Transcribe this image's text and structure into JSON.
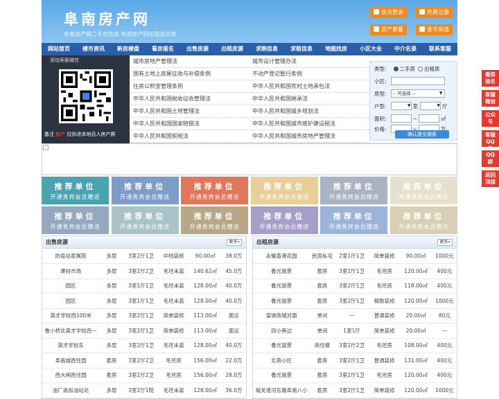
{
  "header": {
    "logo": "阜南房产网",
    "subtitle": "阜南房产网二手房信息    阜南房产网出租房信息",
    "buttons": [
      "会员登录",
      "免费注册",
      "房产套餐",
      "金币充值"
    ]
  },
  "nav": [
    "网站首页",
    "楼市资讯",
    "新房楼盘",
    "看房报名",
    "出售房源",
    "出租房源",
    "求购信息",
    "求租信息",
    "地图找房",
    "小区大全",
    "中介名录",
    "联系客服"
  ],
  "qr": {
    "caption": "添加客服微信",
    "note_prefix": "备注",
    "note_highlight": "房产",
    "note_suffix": "拉你进本地百人房产群"
  },
  "laws_left": [
    "城市房地产管理法",
    "国有土地上房屋征收与补偿条例",
    "住房公积金管理条例",
    "中华人民共和国税收征收管理法",
    "中华人民共和国土地管理法",
    "中华人民共和国国家赔偿法",
    "中华人民共和国契税法"
  ],
  "laws_right": [
    "城市设计管理办法",
    "不动产登记暂行条例",
    "中华人民共和国农村土地承包法",
    "中华人民共和国继承法",
    "中华人民共和国城乡规划法",
    "中华人民共和国城市维护建设税法",
    "中华人民共和国城市房地产管理法"
  ],
  "search": {
    "type_label": "类型:",
    "opt1": "二手房",
    "opt2": "出租房",
    "community_label": "小区:",
    "housetype_label": "房型:",
    "housetype_value": "-- 可选择 --",
    "layout_label": "户型:",
    "room_unit": "室",
    "hall_unit": "厅",
    "area_label": "面积:",
    "area_unit": "㎡",
    "price_label": "价格:",
    "price_unit": "万",
    "range_sep": "~",
    "submit": "确认提交搜索"
  },
  "tiles": {
    "title": "推荐单位",
    "subtitle": "开通贵宾会员赠送"
  },
  "sale": {
    "title": "出售房源",
    "more": "更多»",
    "rows": [
      [
        "防疫站家属院",
        "多层",
        "3室2厅1卫",
        "中档装修",
        "90.00㎡",
        "38.0万"
      ],
      [
        "建材市场",
        "多层",
        "3室2厅2卫",
        "毛坯未装",
        "140.62㎡",
        "45.0万"
      ],
      [
        "园区",
        "多层",
        "3室1厅1卫",
        "毛坯未装",
        "128.00㎡",
        "40.0万"
      ],
      [
        "园区",
        "多层",
        "3室1厅1卫",
        "毛坯未装",
        "128.00㎡",
        "40.0万"
      ],
      [
        "英才学校西100米",
        "多层",
        "3室2厅1卫",
        "简单装修",
        "113.00㎡",
        "面议"
      ],
      [
        "鲁小桥北英才学校西一",
        "多层",
        "3室2厅1卫",
        "简单装修",
        "113.00㎡",
        "面议"
      ],
      [
        "英才学校东",
        "多层",
        "3室2厅1卫",
        "毛坯未装",
        "128.00㎡",
        "40.0万"
      ],
      [
        "阜南城西住园",
        "套房",
        "3室2厅2卫",
        "毛坯房",
        "156.00㎡",
        "22.0万"
      ],
      [
        "西大闸西住园",
        "套房",
        "3室2厅2卫",
        "毛坯房",
        "156.00㎡",
        "28.0万"
      ],
      [
        "油厂南加油站北",
        "多层",
        "3室2厅1院",
        "毛坯未装",
        "128.00㎡",
        "36.0万"
      ]
    ]
  },
  "rent": {
    "title": "出租房源",
    "more": "更多»",
    "rows": [
      [
        "永耀香港花园",
        "民房私宅",
        "2室1厅1卫",
        "简单装修",
        "90.00㎡",
        "1000元"
      ],
      [
        "春光丽景",
        "套房",
        "3室2厅1卫",
        "毛坯房",
        "120.00㎡",
        "400元"
      ],
      [
        "春光丽景",
        "套房",
        "3室2厅1卫",
        "毛坯房",
        "118.00㎡",
        "400元"
      ],
      [
        "春光丽景",
        "套房",
        "3室2厅1卫",
        "精致装修",
        "120.00㎡",
        "1000元"
      ],
      [
        "富坡商城对面",
        "单间",
        "—",
        "普通装修",
        "20.00㎡",
        "80元"
      ],
      [
        "四小旁边",
        "单间",
        "1室1厅",
        "简单装修",
        "20.00㎡",
        "—"
      ],
      [
        "春光丽景",
        "商住楼",
        "3室2厅2卫",
        "毛坯房",
        "108.00㎡",
        "400元"
      ],
      [
        "北苑小区",
        "套房",
        "3室2厅1卫",
        "普通装修",
        "131.00㎡",
        "400元"
      ],
      [
        "春光丽景",
        "套房",
        "3室2厅1卫",
        "毛坯房",
        "120.00㎡",
        "400元"
      ],
      [
        "城关淮河东路阜南八小",
        "套房",
        "3室2厅1卫",
        "简单装修",
        "120.00㎡",
        "1000元"
      ]
    ]
  },
  "side": [
    "看房报名",
    "客服微信",
    "公众号",
    "客服QQ号",
    "QQ群",
    "返回顶部"
  ]
}
